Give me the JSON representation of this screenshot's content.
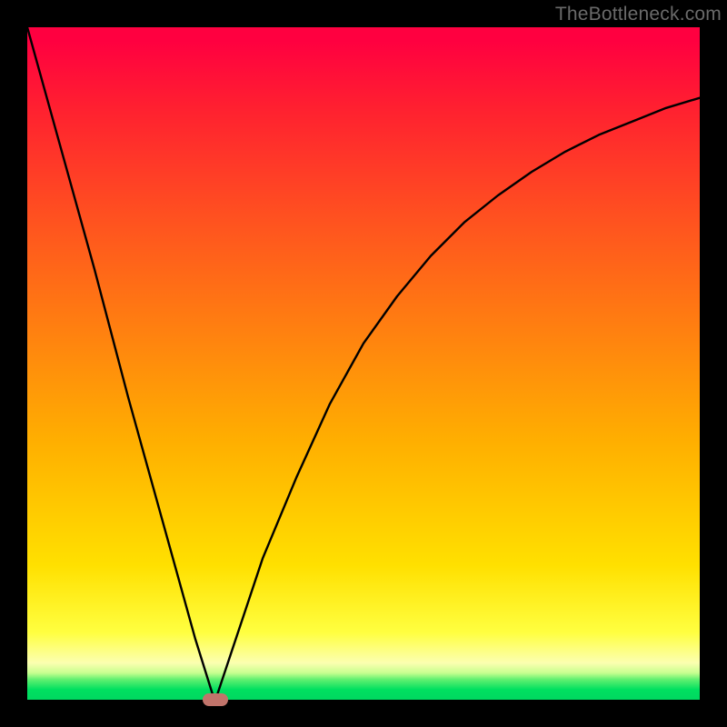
{
  "watermark": "TheBottleneck.com",
  "colors": {
    "marker": "#c1746b",
    "curve": "#000000",
    "background": "#000000"
  },
  "chart_data": {
    "type": "line",
    "title": "",
    "xlabel": "",
    "ylabel": "",
    "xlim": [
      0,
      100
    ],
    "ylim": [
      0,
      100
    ],
    "grid": false,
    "series": [
      {
        "name": "curve",
        "x": [
          0,
          5,
          10,
          15,
          20,
          25,
          27.5,
          28,
          30,
          32,
          35,
          40,
          45,
          50,
          55,
          60,
          65,
          70,
          75,
          80,
          85,
          90,
          95,
          100
        ],
        "values": [
          100,
          82,
          64,
          45,
          27,
          9,
          1,
          0,
          6,
          12,
          21,
          33,
          44,
          53,
          60,
          66,
          71,
          75,
          78.5,
          81.5,
          84,
          86,
          88,
          89.5
        ]
      }
    ],
    "marker": {
      "x": 28,
      "y": 0
    },
    "background_gradient": {
      "stops": [
        {
          "pos": 0,
          "color": "#ff0040"
        },
        {
          "pos": 50,
          "color": "#ffa000"
        },
        {
          "pos": 90,
          "color": "#ffff40"
        },
        {
          "pos": 100,
          "color": "#00d860"
        }
      ]
    }
  }
}
